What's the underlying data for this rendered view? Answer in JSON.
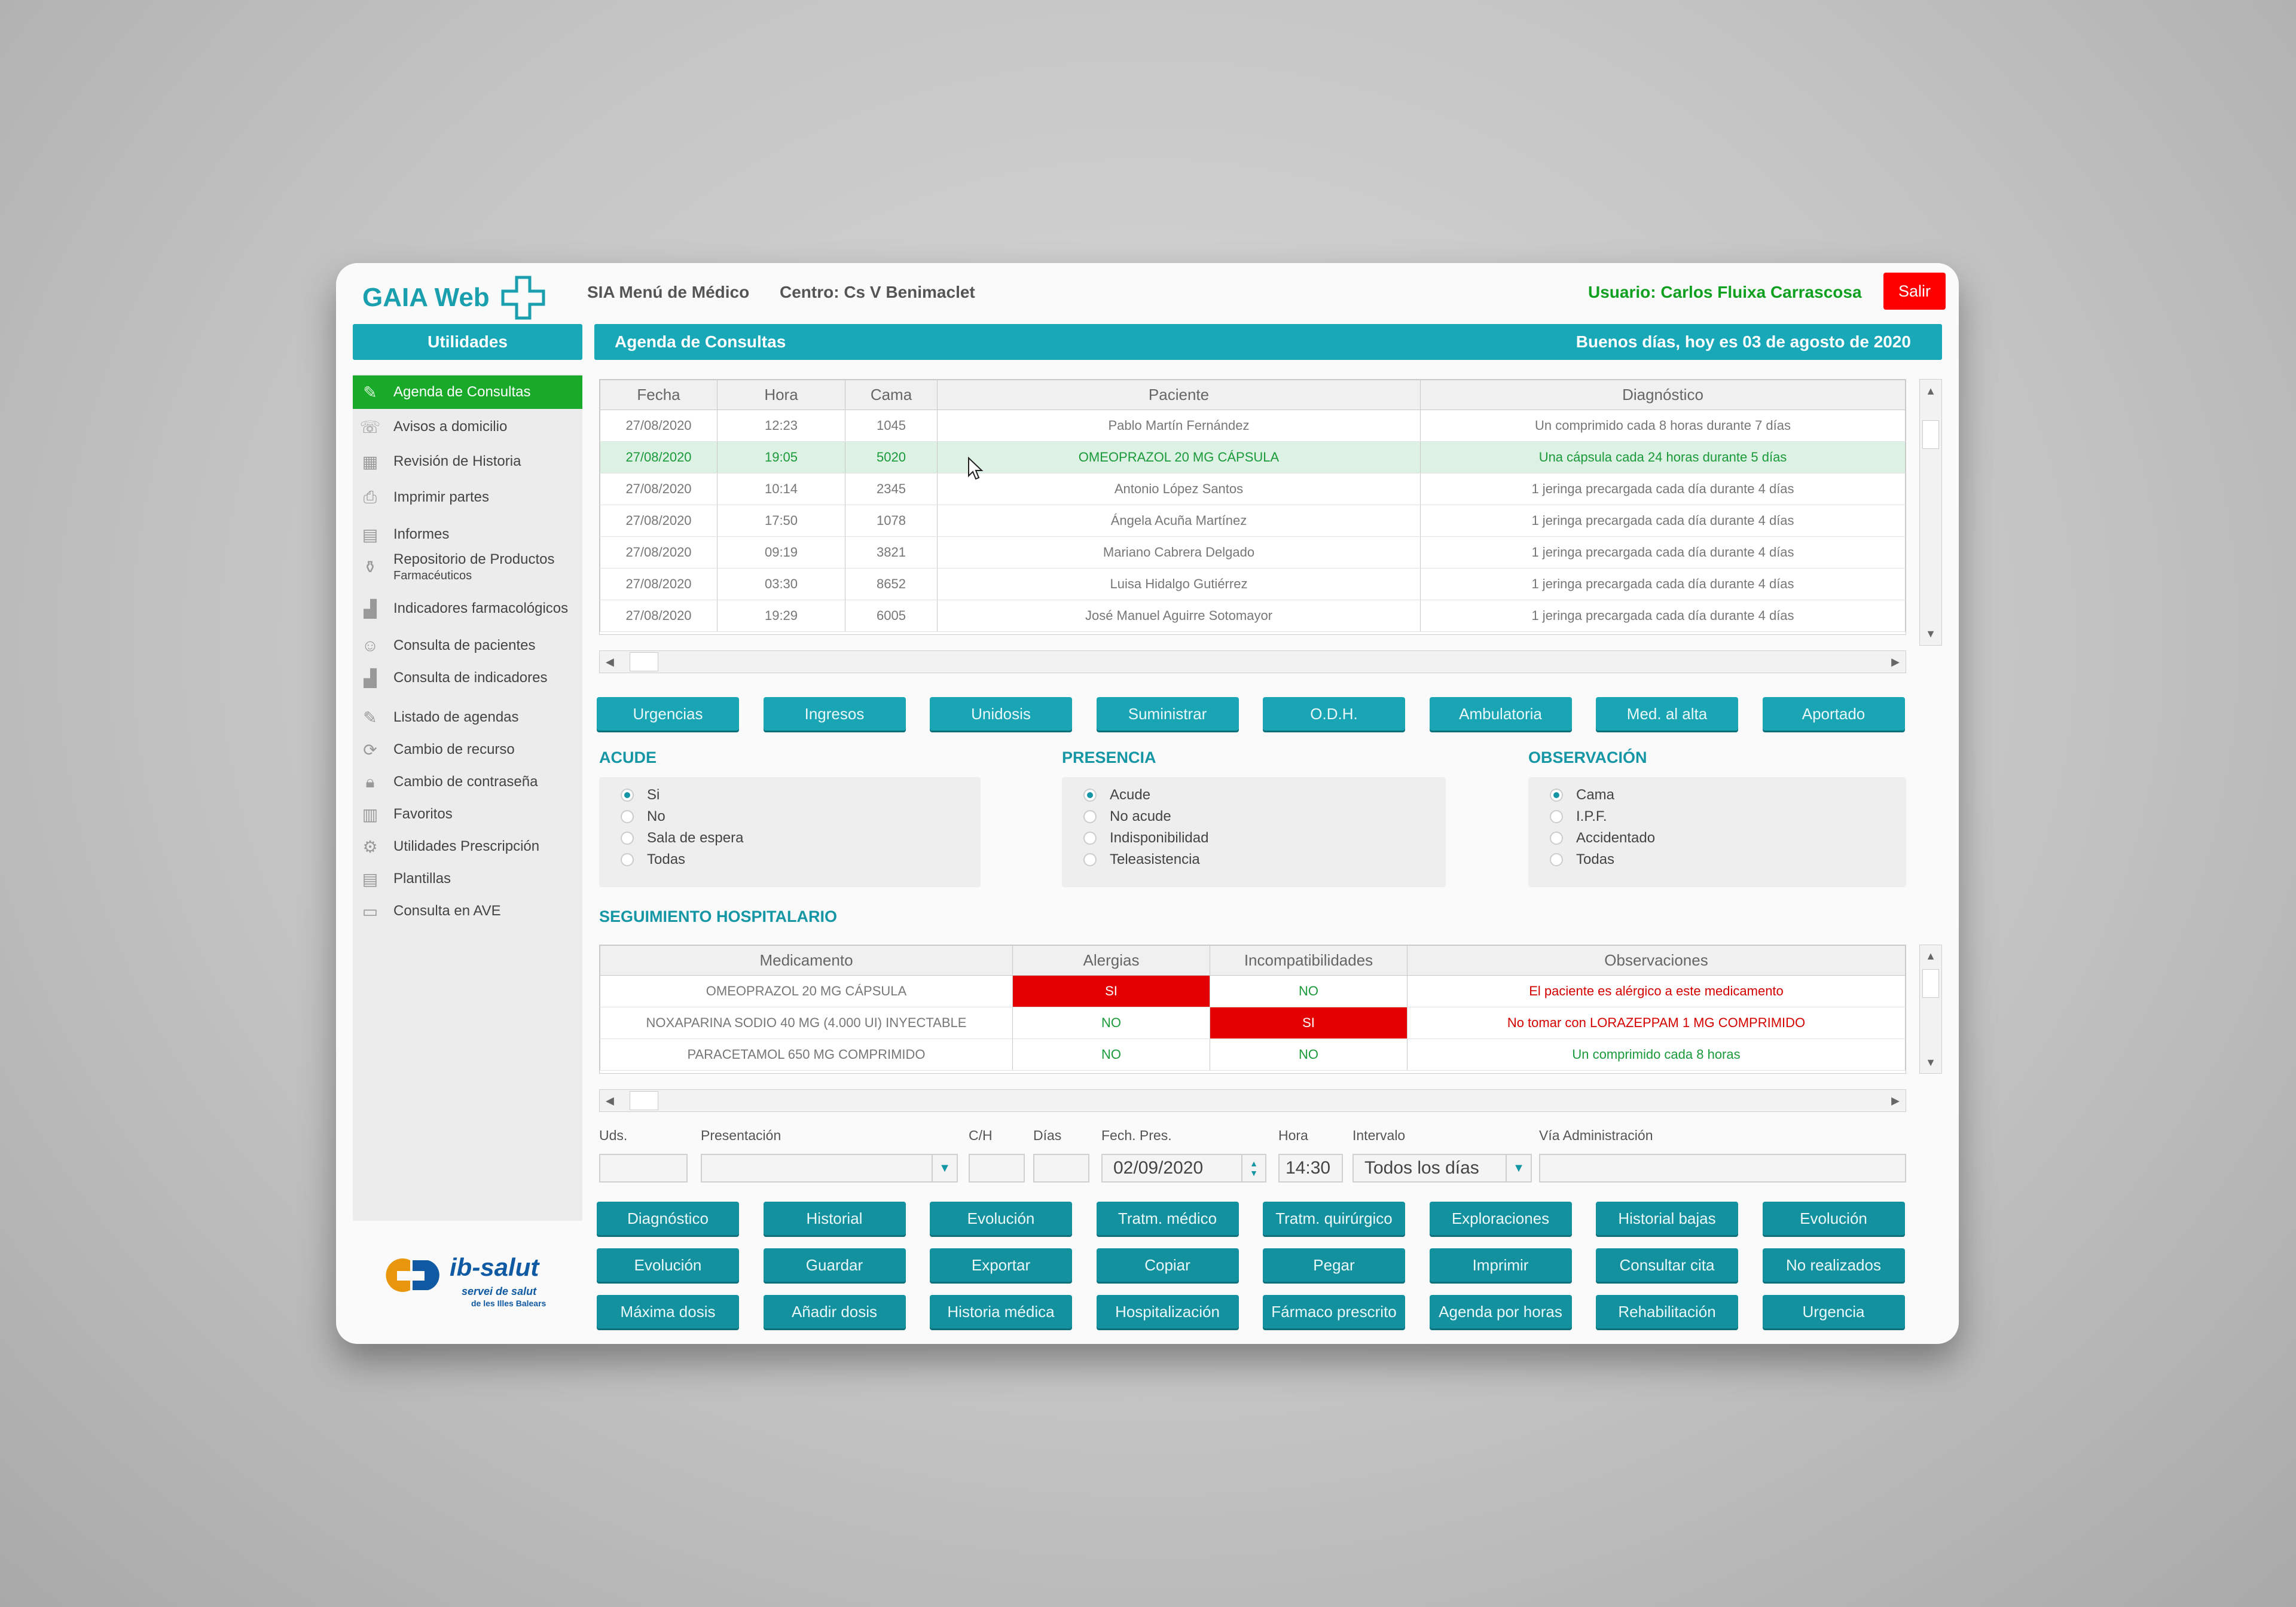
{
  "header": {
    "app_name": "GAIA Web",
    "menu": "SIA Menú de Médico",
    "centro": "Centro: Cs V Benimaclet",
    "usuario": "Usuario: Carlos Fluixa Carrascosa",
    "salir": "Salir"
  },
  "sidebar": {
    "title": "Utilidades",
    "items": [
      {
        "label": "Agenda de Consultas",
        "icon": "calendar-edit-icon"
      },
      {
        "label": "Avisos a domicilio",
        "icon": "phone-icon"
      },
      {
        "label": "Revisión de Historia",
        "icon": "history-icon"
      },
      {
        "label": "Imprimir partes",
        "icon": "printer-icon"
      },
      {
        "label": "Informes",
        "icon": "document-icon"
      },
      {
        "label": "Repositorio de Productos",
        "sub": "Farmacéuticos",
        "icon": "bottle-icon"
      },
      {
        "label": "Indicadores farmacológicos",
        "icon": "chart-icon"
      },
      {
        "label": "Consulta de pacientes",
        "icon": "user-icon"
      },
      {
        "label": "Consulta de indicadores",
        "icon": "chart-icon"
      },
      {
        "label": "Listado de agendas",
        "icon": "list-edit-icon"
      },
      {
        "label": "Cambio de recurso",
        "icon": "refresh-icon"
      },
      {
        "label": "Cambio de contraseña",
        "icon": "lock-icon"
      },
      {
        "label": "Favoritos",
        "icon": "book-icon"
      },
      {
        "label": "Utilidades Prescripción",
        "icon": "gears-icon"
      },
      {
        "label": "Plantillas",
        "icon": "template-icon"
      },
      {
        "label": "Consulta en AVE",
        "icon": "folder-icon"
      }
    ],
    "logo_name": "ib-salut",
    "logo_sub": "servei de salut",
    "logo_sub2": "de les Illes Balears"
  },
  "agenda": {
    "title": "Agenda de Consultas",
    "greeting": "Buenos días, hoy es 03 de agosto de 2020",
    "columns": [
      "Fecha",
      "Hora",
      "Cama",
      "Paciente",
      "Diagnóstico"
    ],
    "rows": [
      [
        "27/08/2020",
        "12:23",
        "1045",
        "Pablo Martín Fernández",
        "Un comprimido cada 8 horas durante 7 días"
      ],
      [
        "27/08/2020",
        "19:05",
        "5020",
        "OMEOPRAZOL 20 MG CÁPSULA",
        "Una cápsula cada 24 horas durante 5 días"
      ],
      [
        "27/08/2020",
        "10:14",
        "2345",
        "Antonio López Santos",
        "1 jeringa precargada cada día durante 4 días"
      ],
      [
        "27/08/2020",
        "17:50",
        "1078",
        "Ángela Acuña Martínez",
        "1 jeringa precargada cada día durante 4 días"
      ],
      [
        "27/08/2020",
        "09:19",
        "3821",
        "Mariano Cabrera Delgado",
        "1 jeringa precargada cada día durante 4 días"
      ],
      [
        "27/08/2020",
        "03:30",
        "8652",
        "Luisa Hidalgo Gutiérrez",
        "1 jeringa precargada cada día durante 4 días"
      ],
      [
        "27/08/2020",
        "19:29",
        "6005",
        "José Manuel Aguirre Sotomayor",
        "1 jeringa precargada cada día durante 4 días"
      ]
    ],
    "selected_row": 1
  },
  "filter_buttons": [
    "Urgencias",
    "Ingresos",
    "Unidosis",
    "Suministrar",
    "O.D.H.",
    "Ambulatoria",
    "Med. al alta",
    "Aportado"
  ],
  "acude": {
    "title": "ACUDE",
    "options": [
      "Si",
      "No",
      "Sala de espera",
      "Todas"
    ],
    "selected": 0
  },
  "presencia": {
    "title": "PRESENCIA",
    "options": [
      "Acude",
      "No acude",
      "Indisponibilidad",
      "Teleasistencia"
    ],
    "selected": 0
  },
  "observacion": {
    "title": "OBSERVACIÓN",
    "options": [
      "Cama",
      "I.P.F.",
      "Accidentado",
      "Todas"
    ],
    "selected": 0
  },
  "seguimiento": {
    "title": "SEGUIMIENTO HOSPITALARIO",
    "columns": [
      "Medicamento",
      "Alergias",
      "Incompatibilidades",
      "Observaciones"
    ],
    "rows": [
      {
        "med": "OMEOPRAZOL 20 MG CÁPSULA",
        "alergias": "SI",
        "incomp": "NO",
        "obs": "El paciente es alérgico a este medicamento",
        "obs_status": "alert"
      },
      {
        "med": "NOXAPARINA SODIO 40 MG (4.000 UI) INYECTABLE",
        "alergias": "NO",
        "incomp": "SI",
        "obs": "No tomar con LORAZEPPAM 1 MG COMPRIMIDO",
        "obs_status": "alert"
      },
      {
        "med": "PARACETAMOL 650 MG COMPRIMIDO",
        "alergias": "NO",
        "incomp": "NO",
        "obs": "Un comprimido cada 8 horas",
        "obs_status": "ok"
      }
    ]
  },
  "form": {
    "uds": "Uds.",
    "presentacion": "Presentación",
    "ch": "C/H",
    "dias": "Días",
    "fech_pres": "Fech. Pres.",
    "fech_value": "02/09/2020",
    "hora": "Hora",
    "hora_value": "14:30",
    "intervalo": "Intervalo",
    "intervalo_value": "Todos los días",
    "via": "Vía Administración"
  },
  "action_rows": [
    [
      "Diagnóstico",
      "Historial",
      "Evolución",
      "Tratm. médico",
      "Tratm. quirúrgico",
      "Exploraciones",
      "Historial bajas",
      "Evolución"
    ],
    [
      "Evolución",
      "Guardar",
      "Exportar",
      "Copiar",
      "Pegar",
      "Imprimir",
      "Consultar cita",
      "No realizados"
    ],
    [
      "Máxima dosis",
      "Añadir dosis",
      "Historia médica",
      "Hospitalización",
      "Fármaco prescrito",
      "Agenda por horas",
      "Rehabilitación",
      "Urgencia"
    ]
  ],
  "colors": {
    "teal": "#18a8b8",
    "green": "#1aaa2a",
    "red": "#e40000",
    "selected_row": "#ddf2e4",
    "ok_text": "#1a9a3a",
    "alert_text": "#d40000"
  }
}
